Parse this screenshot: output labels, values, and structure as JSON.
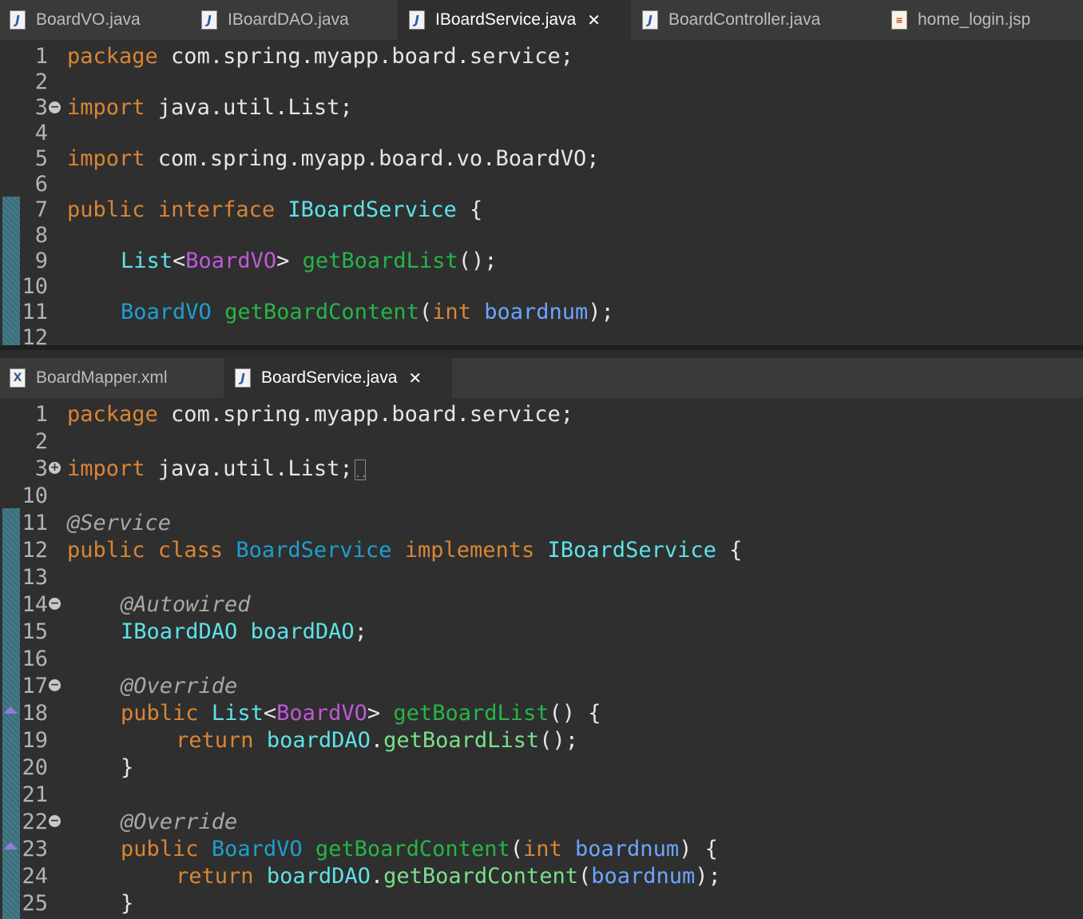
{
  "top_editor": {
    "tabs": [
      {
        "label": "BoardVO.java",
        "icon": "java-file-icon",
        "active": false
      },
      {
        "label": "IBoardDAO.java",
        "icon": "java-file-icon",
        "active": false
      },
      {
        "label": "IBoardService.java",
        "icon": "java-file-icon",
        "active": true
      },
      {
        "label": "BoardController.java",
        "icon": "java-file-icon",
        "active": false
      },
      {
        "label": "home_login.jsp",
        "icon": "jsp-file-icon",
        "active": false
      }
    ],
    "line_numbers": [
      "1",
      "2",
      "3",
      "4",
      "5",
      "6",
      "7",
      "8",
      "9",
      "10",
      "11",
      "12"
    ],
    "code": {
      "l1": [
        "package",
        " com.spring.myapp.board.service;"
      ],
      "l3": [
        "import",
        " java.util.List;"
      ],
      "l5": [
        "import",
        " com.spring.myapp.board.vo.BoardVO;"
      ],
      "l7": [
        "public",
        " ",
        "interface",
        " ",
        "IBoardService",
        " {"
      ],
      "l9": [
        "List",
        "<",
        "BoardVO",
        "> ",
        "getBoardList",
        "();"
      ],
      "l11": [
        "BoardVO",
        " ",
        "getBoardContent",
        "(",
        "int",
        " ",
        "boardnum",
        ");"
      ]
    }
  },
  "bottom_editor": {
    "tabs": [
      {
        "label": "BoardMapper.xml",
        "icon": "xml-file-icon",
        "active": false
      },
      {
        "label": "BoardService.java",
        "icon": "java-file-icon",
        "active": true
      }
    ],
    "line_numbers": [
      "1",
      "2",
      "3",
      "10",
      "11",
      "12",
      "13",
      "14",
      "15",
      "16",
      "17",
      "18",
      "19",
      "20",
      "21",
      "22",
      "23",
      "24",
      "25"
    ],
    "code": {
      "l1": [
        "package",
        " com.spring.myapp.board.service;"
      ],
      "l3": [
        "import",
        " java.util.List;"
      ],
      "l11": [
        "@Service"
      ],
      "l12": [
        "public",
        " ",
        "class",
        " ",
        "BoardService",
        " ",
        "implements",
        " ",
        "IBoardService",
        " {"
      ],
      "l14": [
        "@Autowired"
      ],
      "l15": [
        "IBoardDAO",
        " ",
        "boardDAO",
        ";"
      ],
      "l17": [
        "@Override"
      ],
      "l18": [
        "public",
        " ",
        "List",
        "<",
        "BoardVO",
        "> ",
        "getBoardList",
        "() {"
      ],
      "l19": [
        "return",
        " ",
        "boardDAO",
        ".",
        "getBoardList",
        "();"
      ],
      "l20": [
        "}"
      ],
      "l22": [
        "@Override"
      ],
      "l23": [
        "public",
        " ",
        "BoardVO",
        " ",
        "getBoardContent",
        "(",
        "int",
        " ",
        "boardnum",
        ") {"
      ],
      "l24": [
        "return",
        " ",
        "boardDAO",
        ".",
        "getBoardContent",
        "(",
        "boardnum",
        ");"
      ],
      "l25": [
        "}"
      ]
    }
  }
}
